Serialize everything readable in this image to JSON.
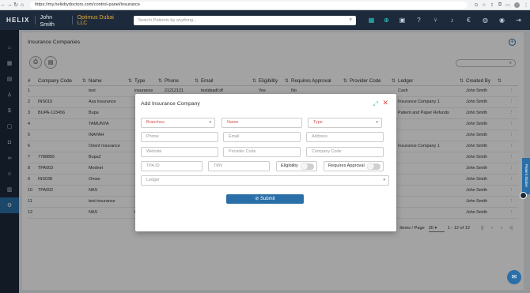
{
  "browser": {
    "url": "https://my.helixbydoctors.com/control-panel/insurance"
  },
  "header": {
    "logo": "HELIX",
    "user_name": "John Smith",
    "company": "Optimus Dubai LLC",
    "search_placeholder": "Search Patients by anything..."
  },
  "page": {
    "title": "Insurance Companies"
  },
  "table": {
    "columns": [
      "#",
      "Company Code",
      "Name",
      "Type",
      "Phone",
      "Email",
      "Eligibility",
      "Requires Approval",
      "Provider Code",
      "Ledger",
      "Created By"
    ],
    "rows": [
      [
        "1",
        "",
        "test",
        "insurance",
        "21212121",
        "testdsadf.df",
        "Yes",
        "No",
        "",
        "Cash",
        "John Smith"
      ],
      [
        "2",
        "INS010",
        "Axa Insurance",
        "",
        "",
        "",
        "",
        "",
        "",
        "Insurance Company 1",
        "John Smith"
      ],
      [
        "3",
        "BUPA-123456",
        "Bupa",
        "",
        "",
        "",
        "",
        "",
        "",
        "Patient and Paper Refunds",
        "John Smith"
      ],
      [
        "4",
        "",
        "TAMUNYA",
        "",
        "",
        "",
        "",
        "",
        "",
        "",
        "John Smith"
      ],
      [
        "5",
        "",
        "INAYAH",
        "",
        "",
        "",
        "",
        "",
        "",
        "",
        "John Smith"
      ],
      [
        "6",
        "",
        "Orient Insurance",
        "",
        "",
        "",
        "",
        "",
        "",
        "Insurance Company 1",
        "John Smith"
      ],
      [
        "7",
        "7788855",
        "Bupa2",
        "",
        "",
        "",
        "",
        "",
        "",
        "",
        "John Smith"
      ],
      [
        "8",
        "TPA003",
        "Mednet",
        "",
        "",
        "",
        "",
        "",
        "",
        "",
        "John Smith"
      ],
      [
        "9",
        "INS038",
        "Oman",
        "",
        "",
        "",
        "",
        "",
        "",
        "",
        "John Smith"
      ],
      [
        "10",
        "TPA002",
        "NAS",
        "",
        "",
        "",
        "",
        "",
        "",
        "",
        "John Smith"
      ],
      [
        "11",
        "",
        "test insurance",
        "",
        "",
        "",
        "",
        "",
        "",
        "",
        "John Smith"
      ],
      [
        "12",
        "",
        "NAS",
        "tpa",
        "",
        "",
        "No",
        "No",
        "",
        "",
        "John Smith"
      ]
    ]
  },
  "pagination": {
    "label": "Items / Page",
    "per_page": "20",
    "range": "1 - 12 of 12"
  },
  "modal": {
    "title": "Add Insurance Company",
    "fields": {
      "branches": "Branches",
      "name": "Name",
      "type": "Type",
      "phone": "Phone",
      "email": "Email",
      "address": "Address",
      "website": "Website",
      "provider_code": "Provider Code",
      "company_code": "Company Code",
      "tpa_id": "TPA ID",
      "trn": "TRN",
      "eligibility": "Eligibility",
      "requires_approval": "Requires Approval",
      "ledger": "Ledger"
    },
    "submit_label": "Submit"
  },
  "side_tab": "Patient Sticker",
  "colors": {
    "header_bg": "#1d2a3b",
    "accent_blue": "#2b6fa8",
    "accent_teal": "#2ecbc9",
    "company_orange": "#e3a73a",
    "required_red": "#d9534f"
  },
  "icons": {
    "header": [
      "search-icon",
      "qr-icon",
      "person-add-icon",
      "calendar-icon",
      "help-icon",
      "branch-icon",
      "bell-icon",
      "currency-icon",
      "globe-icon",
      "user-icon",
      "logout-icon"
    ],
    "sidebar": [
      "home-icon",
      "calendar-icon",
      "document-icon",
      "patient-icon",
      "dollar-icon",
      "box-icon",
      "bag-icon",
      "stethoscope-icon",
      "people-icon",
      "reports-icon",
      "settings-icon"
    ]
  }
}
